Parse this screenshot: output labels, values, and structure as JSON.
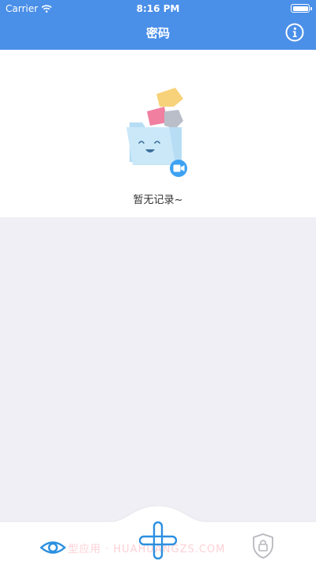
{
  "status_bar": {
    "carrier": "Carrier",
    "time": "8:16 PM"
  },
  "nav": {
    "title": "密码",
    "info_icon": "info-icon"
  },
  "empty_state": {
    "message": "暂无记录~",
    "illustration": "empty-folder-illustration"
  },
  "tab_bar": {
    "items": [
      {
        "icon": "eye-icon"
      },
      {
        "icon": "add-icon"
      },
      {
        "icon": "shield-lock-icon"
      }
    ],
    "watermark": "型应用 · HUAHUANGZS.COM"
  },
  "colors": {
    "brand_blue": "#4a8fe8",
    "background": "#f0eff5"
  }
}
